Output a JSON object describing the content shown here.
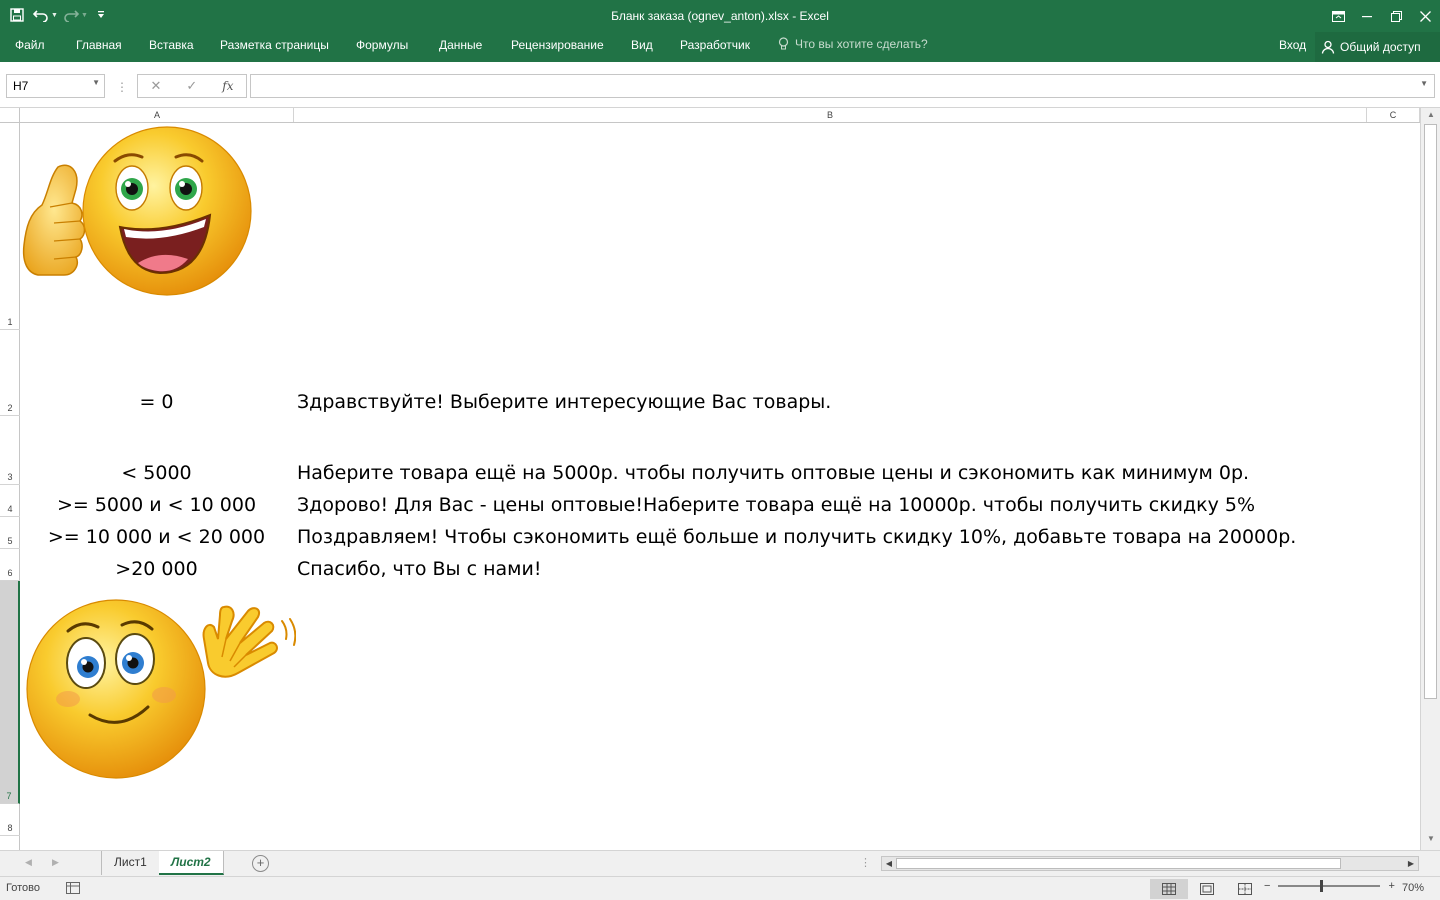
{
  "window": {
    "title": "Бланк заказа (ognev_anton).xlsx - Excel",
    "icons": [
      "save-icon",
      "undo-icon",
      "redo-icon",
      "customize-qat-icon",
      "ribbon-display-icon",
      "minimize-icon",
      "restore-icon",
      "close-icon"
    ]
  },
  "ribbon": {
    "tabs": [
      "Файл",
      "Главная",
      "Вставка",
      "Разметка страницы",
      "Формулы",
      "Данные",
      "Рецензирование",
      "Вид",
      "Разработчик"
    ],
    "tell_me": "Что вы хотите сделать?",
    "login": "Вход",
    "share": "Общий доступ"
  },
  "formula_bar": {
    "name_box": "H7",
    "cancel": "✕",
    "enter": "✓",
    "fx": "fx",
    "formula": ""
  },
  "grid": {
    "columns": [
      "A",
      "B",
      "C"
    ],
    "rows": [
      "1",
      "2",
      "3",
      "4",
      "5",
      "6",
      "7",
      "8"
    ],
    "selected_row": "7",
    "cells": [
      {
        "row": "2",
        "a": "= 0",
        "b": "Здравствуйте! Выберите интересующие Вас товары."
      },
      {
        "row": "3",
        "a": "< 5000",
        "b": "Наберите товара ещё на 5000р. чтобы получить оптовые цены и сэкономить как минимум 0р."
      },
      {
        "row": "4",
        "a": ">= 5000 и < 10 000",
        "b": "Здорово! Для Вас - цены оптовые!Наберите товара ещё на 10000р. чтобы получить скидку 5%"
      },
      {
        "row": "5",
        "a": ">= 10 000 и < 20 000",
        "b": "Поздравляем! Чтобы сэкономить ещё больше и получить скидку 10%, добавьте товара на 20000р."
      },
      {
        "row": "6",
        "a": ">20 000",
        "b": "Спасибо, что Вы с нами!"
      }
    ],
    "pictures": [
      "thumbs-up-smiley",
      "waving-smiley"
    ]
  },
  "sheets": {
    "tabs": [
      "Лист1",
      "Лист2"
    ],
    "active": "Лист2"
  },
  "status": {
    "ready": "Готово",
    "zoom": "70%"
  },
  "colors": {
    "accent": "#217346",
    "smiley_face": "#f5b800",
    "smiley_shade": "#e08a00"
  }
}
